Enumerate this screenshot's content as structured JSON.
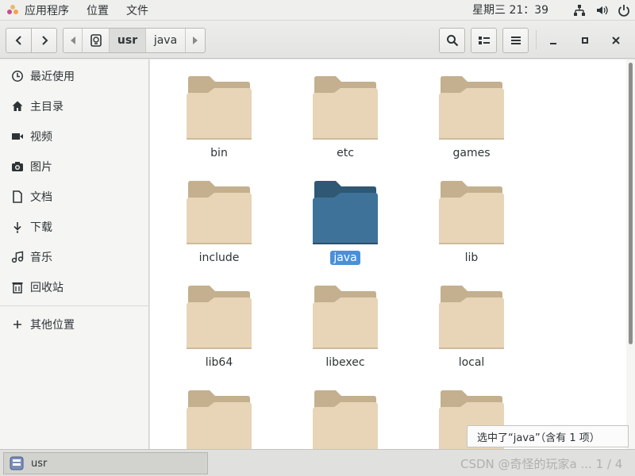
{
  "topbar": {
    "menus": [
      "应用程序",
      "位置",
      "文件"
    ],
    "clock": "星期三 21：39",
    "tray_icons": [
      "network-icon",
      "volume-icon",
      "power-icon"
    ]
  },
  "header": {
    "path": [
      "usr",
      "java"
    ]
  },
  "sidebar": {
    "items": [
      {
        "label": "最近使用",
        "icon": "clock-icon"
      },
      {
        "label": "主目录",
        "icon": "home-icon"
      },
      {
        "label": "视频",
        "icon": "video-icon"
      },
      {
        "label": "图片",
        "icon": "camera-icon"
      },
      {
        "label": "文档",
        "icon": "document-icon"
      },
      {
        "label": "下载",
        "icon": "download-icon"
      },
      {
        "label": "音乐",
        "icon": "music-icon"
      },
      {
        "label": "回收站",
        "icon": "trash-icon"
      }
    ],
    "other": {
      "label": "其他位置",
      "icon": "plus-icon"
    }
  },
  "files": [
    {
      "name": "bin"
    },
    {
      "name": "etc"
    },
    {
      "name": "games"
    },
    {
      "name": "include"
    },
    {
      "name": "java",
      "selected": true
    },
    {
      "name": "lib"
    },
    {
      "name": "lib64"
    },
    {
      "name": "libexec"
    },
    {
      "name": "local"
    },
    {
      "name": ""
    },
    {
      "name": ""
    },
    {
      "name": ""
    }
  ],
  "status": "选中了“java”（含有 1 项）",
  "taskbar": {
    "item_label": "usr",
    "watermark": "CSDN @奇怪的玩家a ... 1 / 4"
  },
  "colors": {
    "folder_body": "#e8d5b7",
    "folder_tab": "#c4b08e",
    "folder_selected_body": "#3e7299",
    "folder_selected_tab": "#2e5873",
    "selection": "#4a90d9"
  }
}
